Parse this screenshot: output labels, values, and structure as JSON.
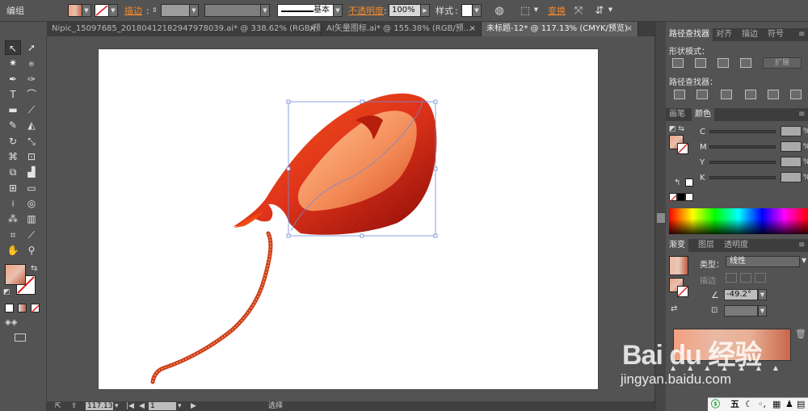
{
  "control_bar": {
    "group_label": "编组",
    "stroke_label": "描边",
    "stroke_profile_label": "基本",
    "opacity_label": "不透明度",
    "opacity_value": "100%",
    "style_label": "样式",
    "transform_label": "变换"
  },
  "tabs": [
    {
      "label": "Nipic_15097685_20180412182947978039.ai* @ 338.62% (RGB/预..."
    },
    {
      "label": "AI矢量图标.ai* @ 155.38% (RGB/预..."
    },
    {
      "label": "未标题-12* @ 117.13% (CMYK/预览)"
    }
  ],
  "tab_close_glyph": "×",
  "status_bar": {
    "zoom": "117.13",
    "page": "1",
    "tool_label": "选择"
  },
  "pathfinder_panel": {
    "tabs": [
      "路径查找器",
      "对齐",
      "描边",
      "符号"
    ],
    "shape_modes_label": "形状模式：",
    "expand_label": "扩展",
    "pathfinders_label": "路径查找器："
  },
  "color_panel": {
    "tabs": [
      "画笔",
      "颜色"
    ],
    "channels": [
      "C",
      "M",
      "Y",
      "K"
    ],
    "percent": "%"
  },
  "gradient_panel": {
    "tabs": [
      "渐变",
      "图层",
      "透明度"
    ],
    "type_label": "类型：",
    "type_value": "线性",
    "stroke_label": "描边",
    "angle_value": "-49.2°"
  },
  "watermark": {
    "logo_text": "Bai du 经验",
    "url": "jingyan.baidu.com"
  },
  "ime_bar": {
    "label": "五"
  },
  "colors": {
    "accent_orange": "#f08a30",
    "ui_panel": "#535353",
    "artwork_red": "#d92a10"
  }
}
